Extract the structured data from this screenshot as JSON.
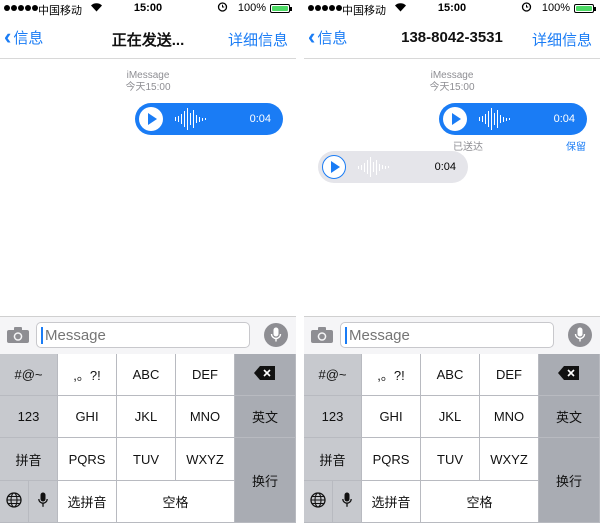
{
  "status_bar": {
    "carrier": "中国移动",
    "time": "15:00",
    "battery": "100%",
    "battery_level": 1.0
  },
  "screens": [
    {
      "nav": {
        "back_label": "信息",
        "title": "正在发送...",
        "details_label": "详细信息"
      },
      "meta": {
        "service": "iMessage",
        "time": "今天15:00"
      },
      "messages": [
        {
          "direction": "out",
          "duration": "0:04"
        }
      ]
    },
    {
      "nav": {
        "back_label": "信息",
        "title": "138-8042-3531",
        "details_label": "详细信息"
      },
      "meta": {
        "service": "iMessage",
        "time": "今天15:00"
      },
      "messages": [
        {
          "direction": "out",
          "duration": "0:04",
          "status": "已送达",
          "action": "保留"
        },
        {
          "direction": "in",
          "duration": "0:04"
        }
      ]
    }
  ],
  "input": {
    "placeholder": "Message"
  },
  "keyboard": {
    "left_col": [
      "#@~",
      "123",
      "拼音"
    ],
    "rows": [
      [
        ",。?!",
        "ABC",
        "DEF"
      ],
      [
        "GHI",
        "JKL",
        "MNO"
      ],
      [
        "PQRS",
        "TUV",
        "WXYZ"
      ]
    ],
    "right_col": {
      "english": "英文",
      "newline": "换行"
    },
    "bottom": {
      "select_pinyin": "选拼音",
      "space": "空格"
    }
  },
  "colors": {
    "accent": "#1a7cf5",
    "incoming": "#e5e5ea",
    "battery": "#4cd964"
  },
  "icons": [
    "wifi-icon",
    "alarm-icon",
    "battery-icon",
    "camera-icon",
    "mic-icon",
    "play-icon",
    "delete-icon",
    "globe-icon"
  ]
}
